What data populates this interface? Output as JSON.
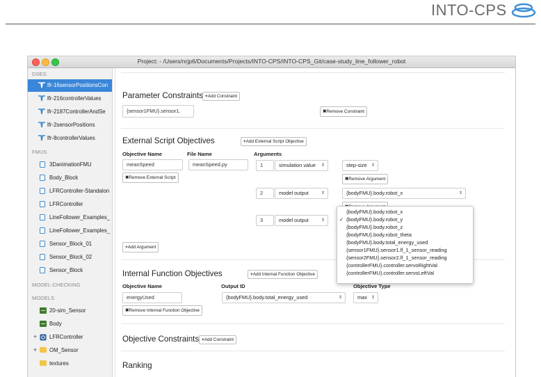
{
  "doc_header": {
    "logo_text": "INTO-CPS"
  },
  "window": {
    "title": "Project: - /Users/nrjp6/Documents/Projects/INTO-CPS/INTO-CPS_Git/case-study_line_follower_robot"
  },
  "sidebar": {
    "dses_label": "DSES",
    "dses": [
      "lfr-16sensorPositionsCon",
      "lfr-216controllerValues",
      "lfr-2187ControllerAndSe",
      "lfr-2sensorPositions",
      "lfr-8controllerValues"
    ],
    "fmus_label": "FMUS",
    "fmus": [
      "3DanimationFMU",
      "Body_Block",
      "LFRController-Standalon",
      "LFRController",
      "LineFollower_Examples_",
      "LineFollower_Examples_",
      "Sensor_Block_01",
      "Sensor_Block_02",
      "Sensor_Block"
    ],
    "model_checking_label": "MODEL-CHECKING",
    "models_label": "MODELS",
    "models": [
      {
        "label": "20-sim_Sensor",
        "expander": ""
      },
      {
        "label": "Body",
        "expander": ""
      },
      {
        "label": "LFRController",
        "expander": "+"
      },
      {
        "label": "OM_Sensor",
        "expander": "+"
      },
      {
        "label": "textures",
        "expander": ""
      }
    ]
  },
  "parameter_constraints": {
    "heading": "Parameter Constraints",
    "add_button": "Add Constraint",
    "constraint_value": "{sensor1FMU}.sensor1.",
    "remove_button": "Remove Constraint"
  },
  "external_script": {
    "heading": "External Script Objectives",
    "add_button": "Add External Script Objective",
    "col_objective": "Objective Name",
    "col_file": "File Name",
    "col_arguments": "Arguments",
    "objective_name": "meanSpeed",
    "file_name": "meanSpeed.py",
    "remove_button": "Remove External Script",
    "arguments": [
      {
        "index": "1",
        "type": "simulation value",
        "value": "step-size"
      },
      {
        "index": "2",
        "type": "model output",
        "value": "{bodyFMU}.body.robot_x"
      },
      {
        "index": "3",
        "type": "model output",
        "value": ""
      }
    ],
    "remove_argument": "Remove Argument",
    "add_argument": "Add Argument",
    "dropdown_options": [
      {
        "label": "{bodyFMU}.body.robot_x",
        "check": ""
      },
      {
        "label": "{bodyFMU}.body.robot_y",
        "check": "✓"
      },
      {
        "label": "{bodyFMU}.body.robot_z",
        "check": ""
      },
      {
        "label": "{bodyFMU}.body.robot_theta",
        "check": ""
      },
      {
        "label": "{bodyFMU}.body.total_energy_used",
        "check": ""
      },
      {
        "label": "{sensor1FMU}.sensor1.lf_1_sensor_reading",
        "check": ""
      },
      {
        "label": "{sensor2FMU}.sensor2.lf_1_sensor_reading",
        "check": ""
      },
      {
        "label": "{controllerFMU}.controller.servoRightVal",
        "check": ""
      },
      {
        "label": "{controllerFMU}.controller.servoLeftVal",
        "check": ""
      }
    ]
  },
  "internal_function": {
    "heading": "Internal Function Objectives",
    "add_button": "Add Internal Function Objective",
    "col_objective": "Objective Name",
    "col_output": "Output ID",
    "col_type": "Objective Type",
    "objective_name": "energyUsed",
    "output_id": "{bodyFMU}.body.total_energy_used",
    "objective_type": "max",
    "remove_button": "Remove Internal Function Objective"
  },
  "objective_constraints": {
    "heading": "Objective Constraints",
    "add_button": "Add Constraint"
  },
  "ranking": {
    "heading": "Ranking"
  },
  "icons": {
    "plus": "+",
    "remove": "✖",
    "updown": "⇕"
  },
  "colors": {
    "selection": "#3a86d8",
    "logo_blue": "#3d8fd6"
  }
}
